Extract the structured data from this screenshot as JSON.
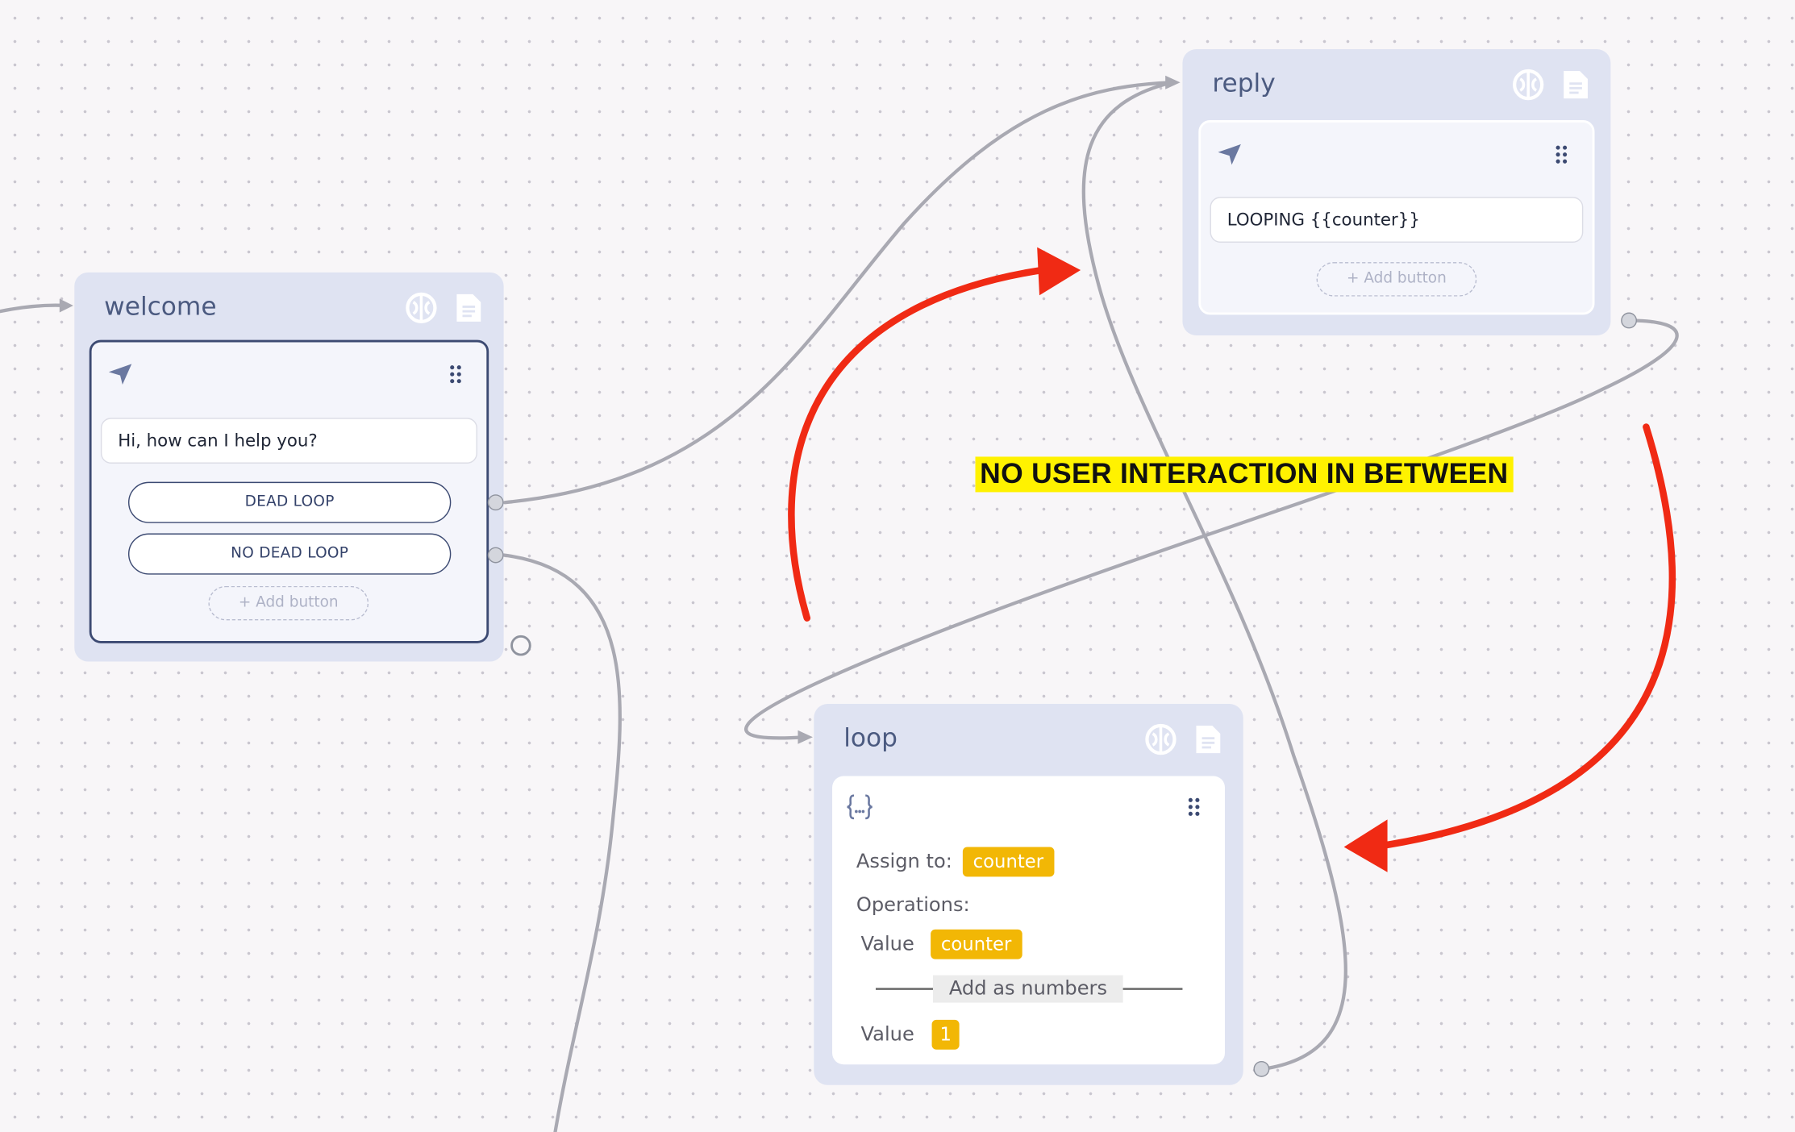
{
  "nodes": {
    "welcome": {
      "title": "welcome",
      "message": "Hi, how can I help you?",
      "buttons": [
        "DEAD LOOP",
        "NO DEAD LOOP"
      ],
      "add_button_label": "+ Add button"
    },
    "reply": {
      "title": "reply",
      "message": "LOOPING {{counter}}",
      "add_button_label": "+ Add button"
    },
    "loop": {
      "title": "loop",
      "assign_label": "Assign to:",
      "assign_variable": "counter",
      "operations_label": "Operations:",
      "value1_label": "Value",
      "value1": "counter",
      "operation": "Add as numbers",
      "value2_label": "Value",
      "value2": "1"
    }
  },
  "annotation": {
    "text": "NO USER INTERACTION IN BETWEEN"
  },
  "colors": {
    "node_background": "#dfe3f2",
    "node_title": "#4b5a80",
    "variable_chip": "#f2b705",
    "annotation_highlight": "#fff200",
    "annotation_arrow": "#f02a14",
    "connection_line": "#a9a9b2"
  },
  "icons": [
    "ai-brain-icon",
    "document-icon",
    "send-icon",
    "drag-handle-icon",
    "code-braces-icon"
  ]
}
